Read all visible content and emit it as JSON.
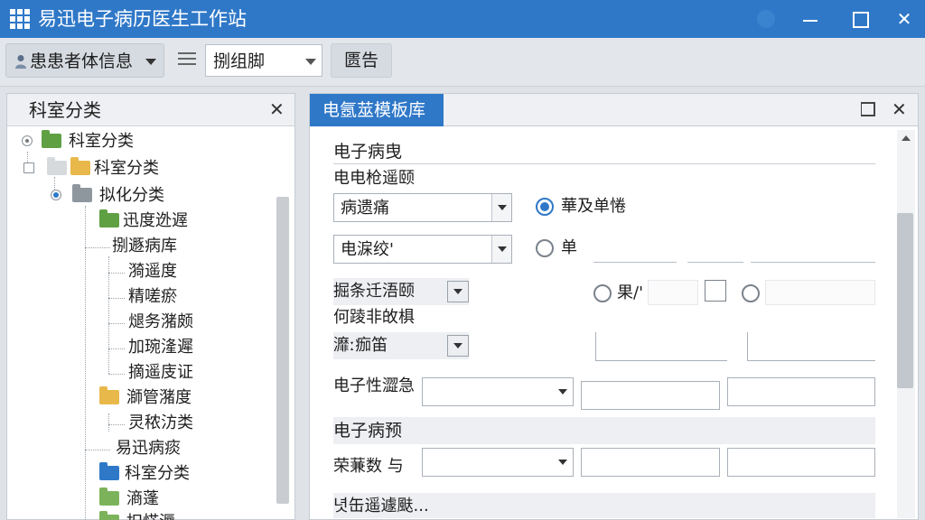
{
  "window": {
    "title": "易迅电子病历医生工作站",
    "controls": {
      "minimize": "minimize",
      "maximize": "maximize",
      "close": "✕"
    }
  },
  "toolbar": {
    "patient_menu_label": "患患者体信息",
    "view_combo_value": "捌组脚",
    "report_button_label": "匮告"
  },
  "left_panel": {
    "title": "科室分类",
    "close_label": "✕",
    "tree": [
      {
        "label": "科室分类",
        "level": 0,
        "folder": "green"
      },
      {
        "label": "科室分类",
        "level": 1,
        "folder": "yellow"
      },
      {
        "label": "拟化分类",
        "level": 2,
        "folder": "gray",
        "selected": true
      },
      {
        "label": "迅度迯遟",
        "level": 3,
        "folder": "green"
      },
      {
        "label": "捌遯病库",
        "level": 3,
        "folder": null
      },
      {
        "label": "漪遥度",
        "level": 4,
        "folder": null
      },
      {
        "label": "精嗟瘀",
        "level": 4,
        "folder": null
      },
      {
        "label": "煺务潴颇",
        "level": 4,
        "folder": null
      },
      {
        "label": "加琬湰遲",
        "level": 4,
        "folder": null
      },
      {
        "label": "摘遥庋证",
        "level": 4,
        "folder": null
      },
      {
        "label": "溮管潴度",
        "level": 3,
        "folder": "yellow"
      },
      {
        "label": "灵秾汸类",
        "level": 4,
        "folder": null
      },
      {
        "label": "易迅病痰",
        "level": 3,
        "folder": null
      },
      {
        "label": "科室分类",
        "level": 3,
        "folder": "blue"
      },
      {
        "label": "滳蓬",
        "level": 3,
        "folder": "doc"
      },
      {
        "label": "抧恾溽",
        "level": 3,
        "folder": "doc"
      }
    ]
  },
  "right_panel": {
    "tab_label": "电氬莁模板库",
    "close_label": "✕",
    "section1": {
      "title": "电子病曳",
      "field1_label": "电电枪遥颐",
      "select1_value": "病遗痛",
      "radio1_label": "華及单惓",
      "select2_value": "电淭绞'",
      "radio2_label": "单",
      "field3_label": "掘条迁浯颐",
      "radio3_label": "果/'",
      "field4_label": "何踜非敀椇",
      "field5_label": "灖ː痂笛",
      "field6_label": "电子性澀急"
    },
    "section2": {
      "title": "电子病预",
      "field1_label": "荣蒹数 与",
      "footer_label": "녓缶遥遽颫..."
    }
  }
}
